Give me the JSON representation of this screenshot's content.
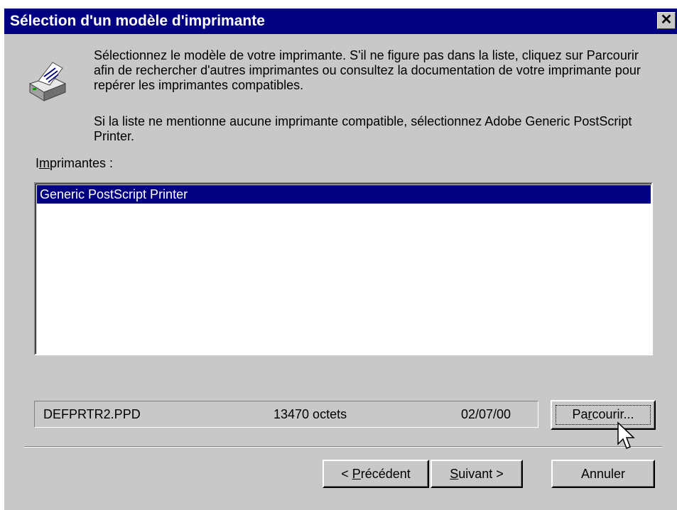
{
  "window": {
    "title": "Sélection d'un modèle d'imprimante",
    "close_glyph": "✕"
  },
  "icons": {
    "printer": "printer-icon",
    "close": "close-icon",
    "cursor": "mouse-cursor-icon"
  },
  "message": {
    "line1": "Sélectionnez le modèle de votre imprimante. S'il ne figure pas dans la liste, cliquez sur Parcourir afin de rechercher d'autres imprimantes ou consultez la documentation de votre imprimante pour repérer les imprimantes compatibles.",
    "line2": "Si la liste ne mentionne aucune imprimante compatible, sélectionnez Adobe Generic PostScript Printer."
  },
  "printers": {
    "label_prefix": "I",
    "label_underlined": "m",
    "label_rest": "primantes :",
    "items": [
      "Generic PostScript Printer"
    ],
    "selected_index": 0
  },
  "file_info": {
    "filename": "DEFPRTR2.PPD",
    "size": "13470 octets",
    "date": "02/07/00"
  },
  "buttons": {
    "browse": {
      "before": "Pa",
      "mnemonic": "r",
      "after": "courir..."
    },
    "previous": {
      "before": "< ",
      "mnemonic": "P",
      "after": "récédent"
    },
    "next": {
      "before": "",
      "mnemonic": "S",
      "after": "uivant >"
    },
    "cancel": "Annuler"
  },
  "colors": {
    "titlebar": "#000080",
    "selection": "#000080",
    "face": "#c8c8c8"
  }
}
